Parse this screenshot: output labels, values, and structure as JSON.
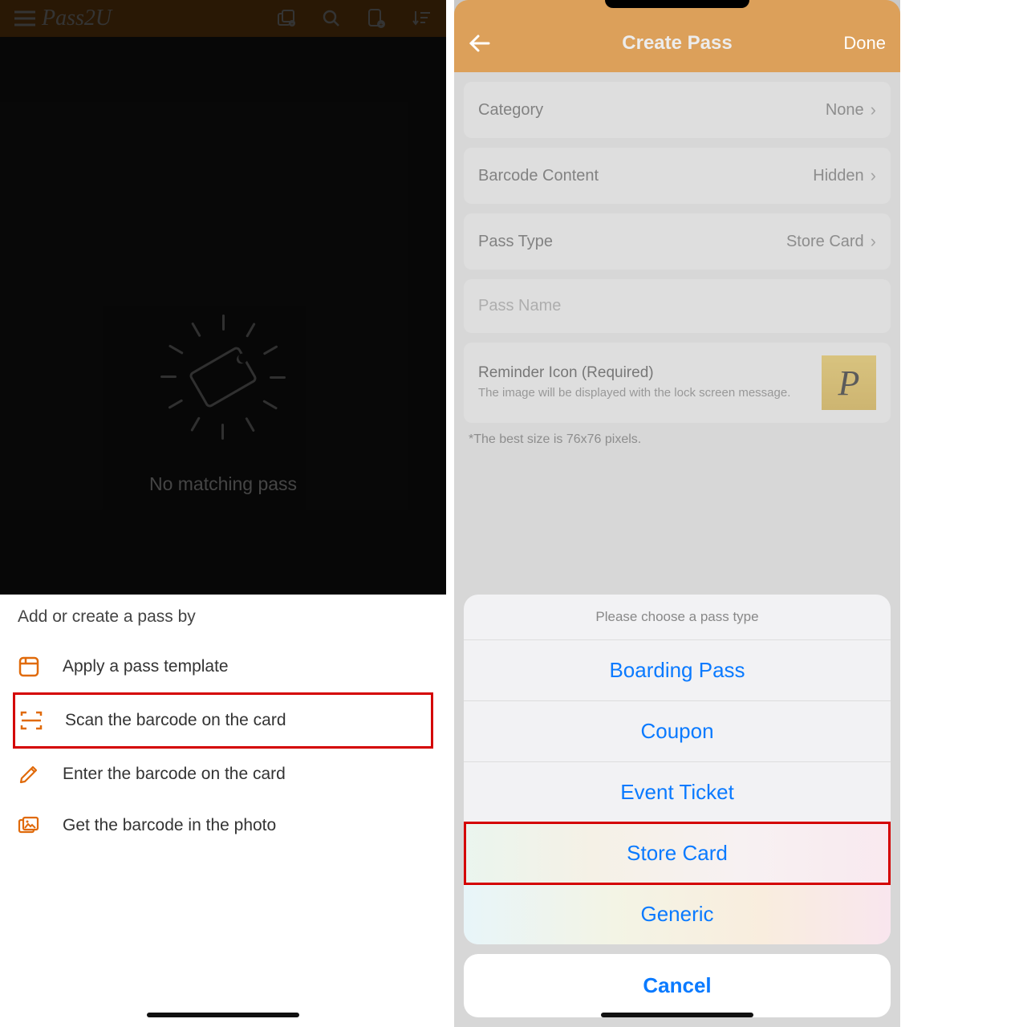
{
  "left": {
    "header": {
      "logo": "Pass2U"
    },
    "empty_text": "No matching pass",
    "sheet_title": "Add or create a pass by",
    "items": [
      {
        "label": "Apply a pass template"
      },
      {
        "label": "Scan the barcode on the card"
      },
      {
        "label": "Enter the barcode on the card"
      },
      {
        "label": "Get the barcode in the photo"
      }
    ]
  },
  "right": {
    "header": {
      "title": "Create Pass",
      "done": "Done"
    },
    "rows": {
      "category": {
        "label": "Category",
        "value": "None"
      },
      "barcode": {
        "label": "Barcode Content",
        "value": "Hidden"
      },
      "passtype": {
        "label": "Pass Type",
        "value": "Store Card"
      }
    },
    "pass_name_placeholder": "Pass Name",
    "reminder": {
      "title": "Reminder Icon (Required)",
      "sub": "The image will be displayed with the lock screen message.",
      "icon_letter": "P"
    },
    "hint": "*The best size is 76x76 pixels.",
    "sheet": {
      "title": "Please choose a pass type",
      "options": [
        "Boarding Pass",
        "Coupon",
        "Event Ticket",
        "Store Card",
        "Generic"
      ],
      "cancel": "Cancel"
    }
  }
}
